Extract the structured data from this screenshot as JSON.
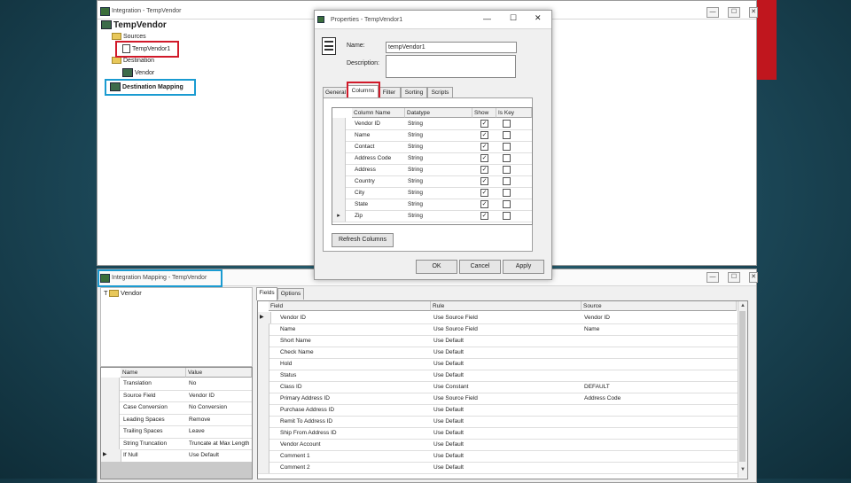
{
  "integration_window": {
    "title": "Integration - TempVendor",
    "root": "TempVendor",
    "sources_label": "Sources",
    "source_item": "TempVendor1",
    "destination_label": "Destination",
    "destination_item": "Vendor",
    "destination_mapping_label": "Destination Mapping"
  },
  "properties_dialog": {
    "title": "Properties - TempVendor1",
    "name_label": "Name:",
    "name_value": "tempVendor1",
    "description_label": "Description:",
    "description_value": "",
    "tabs": [
      "General",
      "Columns",
      "Filter",
      "Sorting",
      "Scripts"
    ],
    "columns_headers": [
      "Column Name",
      "Datatype",
      "Show",
      "Is Key"
    ],
    "rows": [
      {
        "name": "Vendor ID",
        "type": "String",
        "show": true,
        "key": false
      },
      {
        "name": "Name",
        "type": "String",
        "show": true,
        "key": false
      },
      {
        "name": "Contact",
        "type": "String",
        "show": true,
        "key": false
      },
      {
        "name": "Address Code",
        "type": "String",
        "show": true,
        "key": false
      },
      {
        "name": "Address",
        "type": "String",
        "show": true,
        "key": false
      },
      {
        "name": "Country",
        "type": "String",
        "show": true,
        "key": false
      },
      {
        "name": "City",
        "type": "String",
        "show": true,
        "key": false
      },
      {
        "name": "State",
        "type": "String",
        "show": true,
        "key": false
      },
      {
        "name": "Zip",
        "type": "String",
        "show": true,
        "key": false
      }
    ],
    "refresh_label": "Refresh Columns",
    "ok_label": "OK",
    "cancel_label": "Cancel",
    "apply_label": "Apply",
    "min_glyph": "—",
    "max_glyph": "☐",
    "close_glyph": "✕"
  },
  "mapping_window": {
    "title": "Integration Mapping - TempVendor",
    "tree_root": "Vendor",
    "prop_headers": [
      "Name",
      "Value"
    ],
    "props": [
      {
        "name": "Translation",
        "value": "No"
      },
      {
        "name": "Source Field",
        "value": "Vendor ID"
      },
      {
        "name": "Case Conversion",
        "value": "No Conversion"
      },
      {
        "name": "Leading Spaces",
        "value": "Remove"
      },
      {
        "name": "Trailing Spaces",
        "value": "Leave"
      },
      {
        "name": "String Truncation",
        "value": "Truncate at Max Length"
      },
      {
        "name": "If Null",
        "value": "Use Default"
      }
    ],
    "tabs": [
      "Fields",
      "Options"
    ],
    "field_headers": [
      "Field",
      "Rule",
      "Source"
    ],
    "fields": [
      {
        "field": "Vendor ID",
        "rule": "Use Source Field",
        "source": "Vendor ID"
      },
      {
        "field": "Name",
        "rule": "Use Source Field",
        "source": "Name"
      },
      {
        "field": "Short Name",
        "rule": "Use Default",
        "source": ""
      },
      {
        "field": "Check Name",
        "rule": "Use Default",
        "source": ""
      },
      {
        "field": "Hold",
        "rule": "Use Default",
        "source": ""
      },
      {
        "field": "Status",
        "rule": "Use Default",
        "source": ""
      },
      {
        "field": "Class ID",
        "rule": "Use Constant",
        "source": "DEFAULT"
      },
      {
        "field": "Primary Address ID",
        "rule": "Use Source Field",
        "source": "Address Code"
      },
      {
        "field": "Purchase Address ID",
        "rule": "Use Default",
        "source": ""
      },
      {
        "field": "Remit To Address ID",
        "rule": "Use Default",
        "source": ""
      },
      {
        "field": "Ship From Address ID",
        "rule": "Use Default",
        "source": ""
      },
      {
        "field": "Vendor Account",
        "rule": "Use Default",
        "source": ""
      },
      {
        "field": "Comment 1",
        "rule": "Use Default",
        "source": ""
      },
      {
        "field": "Comment 2",
        "rule": "Use Default",
        "source": ""
      }
    ]
  },
  "colors": {
    "highlight_red": "#d11a2a",
    "highlight_blue": "#1a9bd1",
    "accent_bar": "#c0161e"
  }
}
